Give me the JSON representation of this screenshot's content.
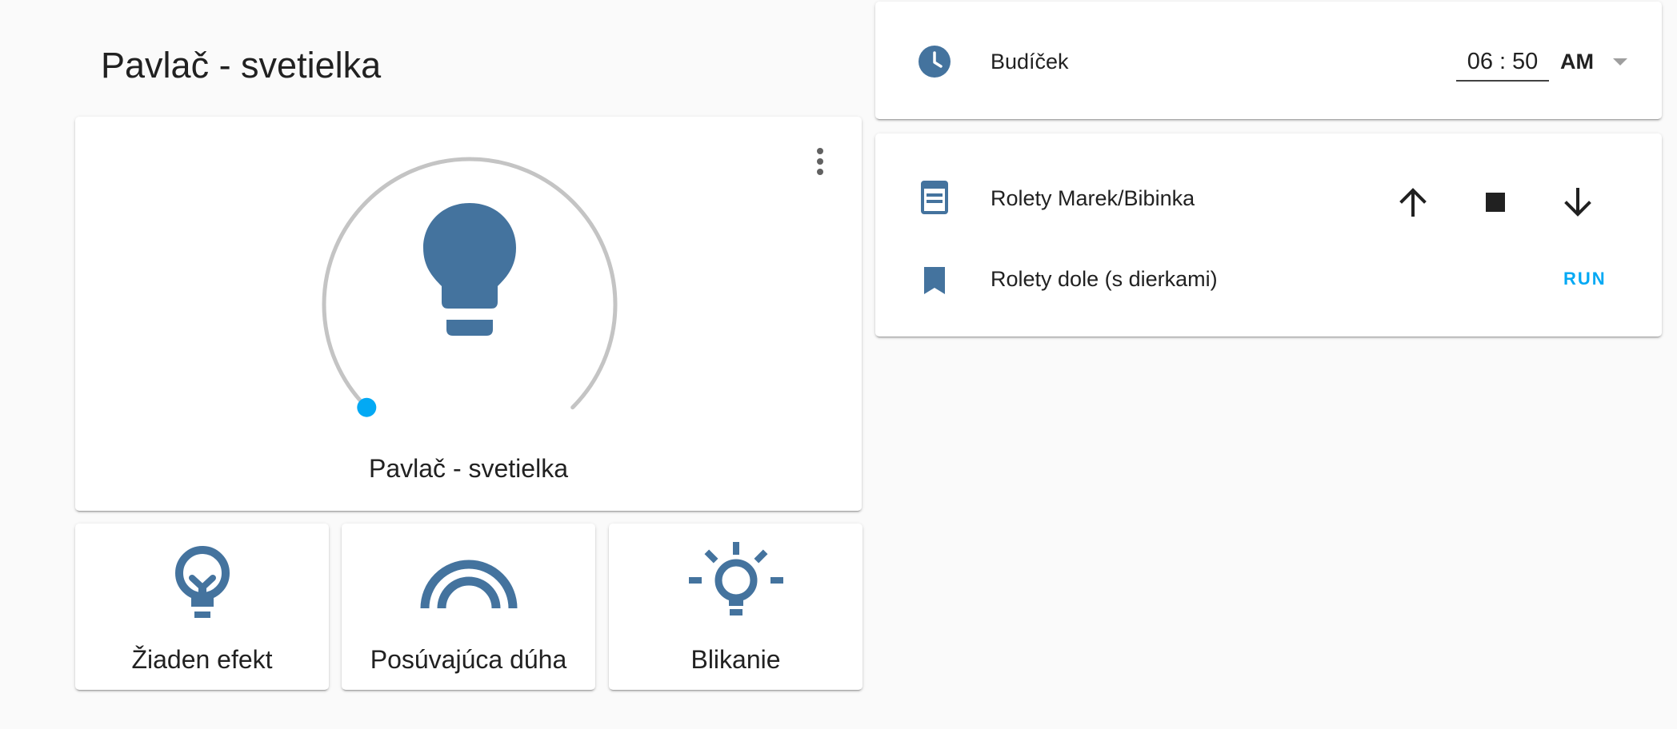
{
  "section": {
    "title": "Pavlač - svetielka"
  },
  "light": {
    "name": "Pavlač - svetielka",
    "brightness_percent": 0,
    "icon": "lightbulb-icon",
    "icon_color": "#44739e",
    "accent_color": "#03a9f4",
    "track_color": "#c4c4c4"
  },
  "effects": [
    {
      "label": "Žiaden efekt",
      "icon": "lightbulb-outline-icon"
    },
    {
      "label": "Posúvajúca dúha",
      "icon": "rainbow-icon"
    },
    {
      "label": "Blikanie",
      "icon": "lightbulb-on-outline-icon"
    }
  ],
  "alarm": {
    "label": "Budíček",
    "icon": "clock-icon",
    "hours": "06",
    "separator": ":",
    "minutes": "50",
    "ampm": "AM"
  },
  "cover": {
    "label": "Rolety Marek/Bibinka",
    "icon": "window-shutter-icon",
    "buttons": [
      "arrow-up-icon",
      "stop-icon",
      "arrow-down-icon"
    ]
  },
  "scene": {
    "label": "Rolety dole (s dierkami)",
    "icon": "bookmark-icon",
    "action_label": "RUN"
  }
}
